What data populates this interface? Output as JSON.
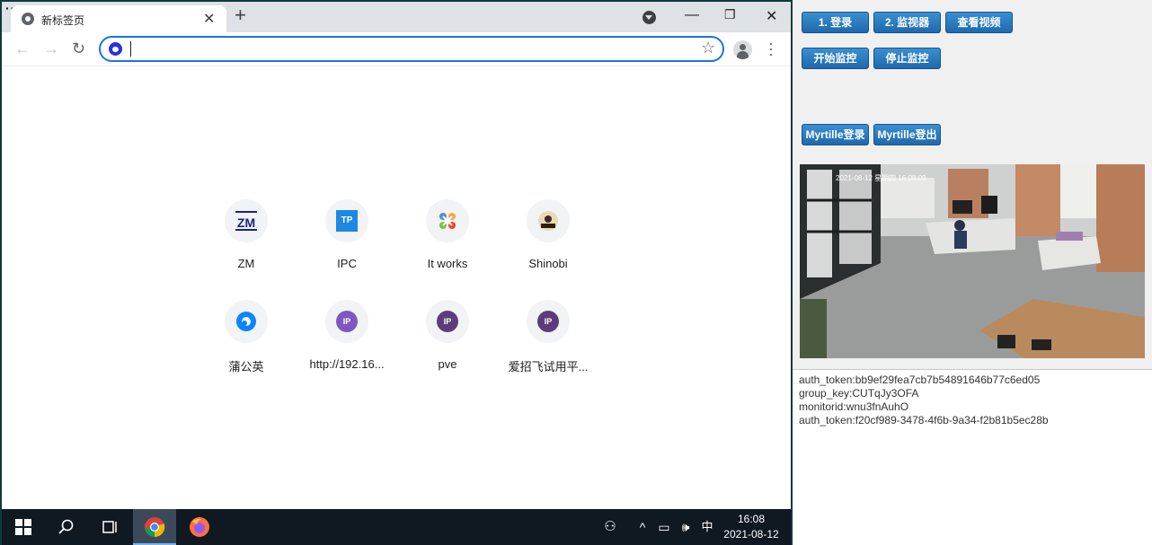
{
  "browser": {
    "tab_title": "新标签页",
    "tab_close": "✕",
    "new_tab": "+",
    "window": {
      "minimize": "—",
      "restore": "❐",
      "close": "✕"
    },
    "nav": {
      "back": "←",
      "forward": "→",
      "reload": "↻"
    },
    "omnibox_value": "",
    "star": "☆",
    "menu": "⋮"
  },
  "shortcuts": [
    {
      "label": "ZM",
      "icon": "zm-icon",
      "badge": "ZM",
      "color": "#1a237e"
    },
    {
      "label": "IPC",
      "icon": "tp-link-icon",
      "badge": "TP",
      "color": "#1e88e5"
    },
    {
      "label": "It works",
      "icon": "joomla-icon",
      "badge": "",
      "color": "#f44336"
    },
    {
      "label": "Shinobi",
      "icon": "shinobi-icon",
      "badge": "",
      "color": "#5d4037"
    },
    {
      "label": "蒲公英",
      "icon": "pgy-icon",
      "badge": "",
      "color": "#0a84ff"
    },
    {
      "label": "http://192.16...",
      "icon": "ip-icon",
      "badge": "IP",
      "color": "#7e57c2"
    },
    {
      "label": "pve",
      "icon": "ip-icon",
      "badge": "IP",
      "color": "#5c3d7a"
    },
    {
      "label": "爱招飞试用平...",
      "icon": "ip-icon",
      "badge": "IP",
      "color": "#5c3d7a"
    }
  ],
  "taskbar": {
    "start": "⊞",
    "search": "⚲",
    "taskview": "⧉",
    "tray_people": "⚇",
    "tray_up": "^",
    "tray_net": "▭",
    "tray_vol": "🕪",
    "ime": "中",
    "time": "16:08",
    "date": "2021-08-12"
  },
  "panel": {
    "buttons": {
      "login": "1. 登录",
      "monitor": "2. 监视器",
      "view_video": "查看视频",
      "start_monitor": "开始监控",
      "stop_monitor": "停止监控",
      "myrtille_login": "Myrtille登录",
      "myrtille_logout": "Myrtille登出"
    },
    "video_overlay": "2021-08-12 星期四 16:08:09",
    "log": [
      "auth_token:bb9ef29fea7cb7b54891646b77c6ed05",
      "group_key:CUTqJy3OFA",
      "monitorid:wnu3fnAuhO",
      "auth_token:f20cf989-3478-4f6b-9a34-f2b81b5ec28b"
    ]
  }
}
